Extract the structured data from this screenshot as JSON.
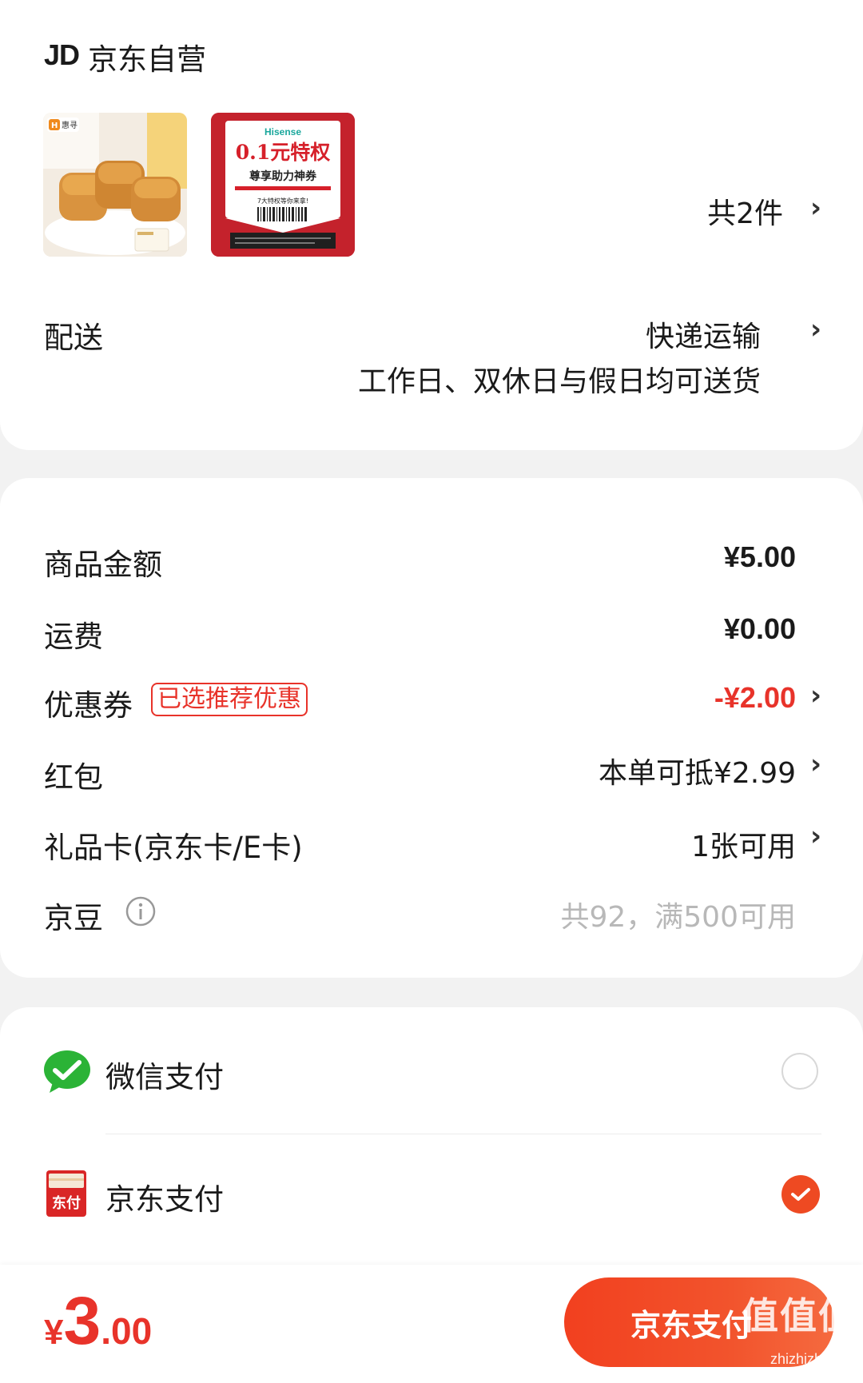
{
  "shop": {
    "logo": "JD",
    "name": "京东自营"
  },
  "products": {
    "items": [
      {
        "name": "bread-product",
        "badge": "惠寻"
      },
      {
        "name": "hisense-coupon",
        "brand": "Hisense",
        "headline": "0.1元特权",
        "subline": "尊享助力神券",
        "note": "7大特权等你来拿!"
      }
    ],
    "count_label": "共2件"
  },
  "delivery": {
    "label": "配送",
    "method": "快递运输",
    "schedule": "工作日、双休日与假日均可送货"
  },
  "price_rows": {
    "goods_amount": {
      "label": "商品金额",
      "value": "¥5.00"
    },
    "shipping": {
      "label": "运费",
      "value": "¥0.00"
    },
    "coupon": {
      "label": "优惠券",
      "tag": "已选推荐优惠",
      "value": "-¥2.00"
    },
    "red_packet": {
      "label": "红包",
      "value": "本单可抵¥2.99"
    },
    "gift_card": {
      "label": "礼品卡(京东卡/E卡)",
      "value": "1张可用"
    },
    "jd_beans": {
      "label": "京豆",
      "value": "共92，满500可用"
    }
  },
  "payment": {
    "options": [
      {
        "label": "微信支付",
        "selected": false,
        "icon": "wechat-pay-icon"
      },
      {
        "label": "京东支付",
        "selected": true,
        "icon": "jd-pay-icon",
        "icon_text": "东付"
      }
    ]
  },
  "footer": {
    "currency": "¥",
    "total_int": "3",
    "total_dec": ".00",
    "pay_button": "京东支付",
    "watermark_text": "值值值",
    "watermark_url": "zhizhizhi.com"
  },
  "colors": {
    "accent": "#e8332a",
    "pay_button": "#f2401f",
    "wechat": "#2bb336",
    "page_bg": "#f2f2f2"
  }
}
